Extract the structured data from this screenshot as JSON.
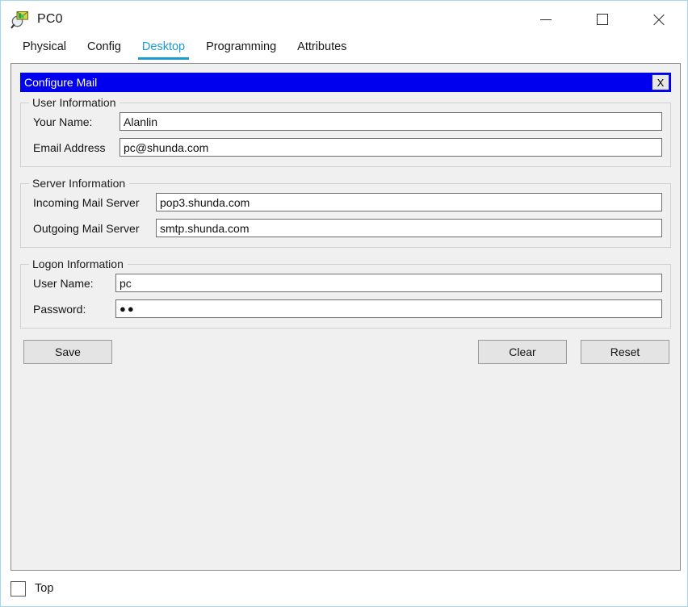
{
  "window": {
    "title": "PC0",
    "app_icon": "magnifier-envelope-icon",
    "controls": {
      "minimize_label": "—",
      "maximize_label": "□",
      "close_label": "✕"
    }
  },
  "tabs": [
    {
      "label": "Physical",
      "active": false
    },
    {
      "label": "Config",
      "active": false
    },
    {
      "label": "Desktop",
      "active": true
    },
    {
      "label": "Programming",
      "active": false
    },
    {
      "label": "Attributes",
      "active": false
    }
  ],
  "dialog": {
    "title": "Configure Mail",
    "close_label": "X",
    "title_bg": "#0000ee",
    "title_fg": "#ffffff"
  },
  "user_information": {
    "legend": "User Information",
    "fields": [
      {
        "label": "Your Name:",
        "value": "Alanlin",
        "placeholder": ""
      },
      {
        "label": "Email Address",
        "value": "pc@shunda.com",
        "placeholder": ""
      }
    ]
  },
  "server_information": {
    "legend": "Server Information",
    "fields": [
      {
        "label": "Incoming Mail Server",
        "value": "pop3.shunda.com",
        "placeholder": ""
      },
      {
        "label": "Outgoing Mail Server",
        "value": "smtp.shunda.com",
        "placeholder": ""
      }
    ]
  },
  "logon_information": {
    "legend": "Logon Information",
    "fields": [
      {
        "label": "User Name:",
        "value": "pc",
        "placeholder": ""
      },
      {
        "label": "Password:",
        "value": "●●",
        "placeholder": ""
      }
    ]
  },
  "buttons": {
    "save": "Save",
    "clear": "Clear",
    "reset": "Reset"
  },
  "statusbar": {
    "checkbox_label": "Top",
    "checked": false
  },
  "accent_color": "#1b9bd1"
}
